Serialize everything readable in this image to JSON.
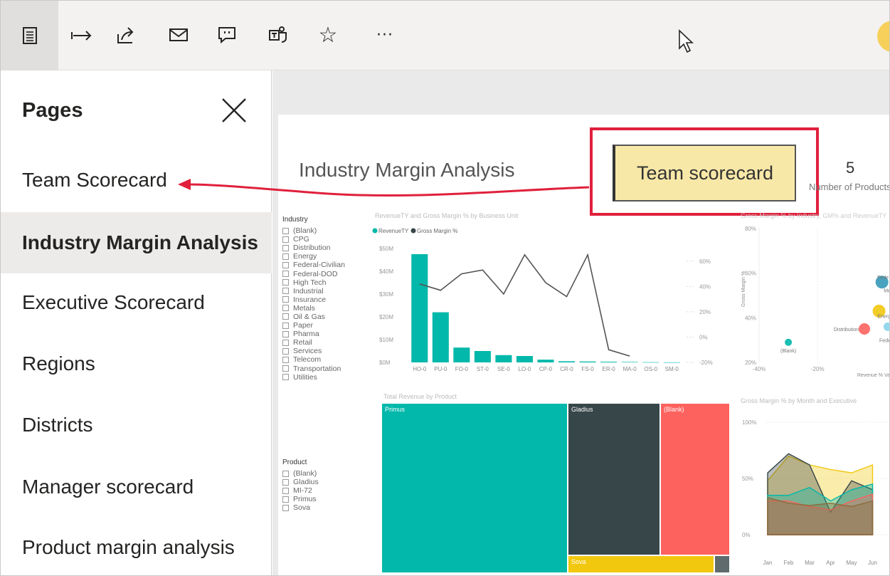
{
  "toolbar": {
    "icons": [
      "pages-icon",
      "expand-icon",
      "share-icon",
      "mail-icon",
      "comment-icon",
      "teams-icon",
      "favorite-icon",
      "more-icon"
    ],
    "more_label": "···"
  },
  "sidebar": {
    "title": "Pages",
    "items": [
      {
        "label": "Team Scorecard",
        "selected": false
      },
      {
        "label": "Industry Margin Analysis",
        "selected": true
      },
      {
        "label": "Executive Scorecard",
        "selected": false
      },
      {
        "label": "Regions",
        "selected": false
      },
      {
        "label": "Districts",
        "selected": false
      },
      {
        "label": "Manager scorecard",
        "selected": false
      },
      {
        "label": "Product margin analysis",
        "selected": false
      }
    ]
  },
  "report": {
    "title": "Industry Margin Analysis",
    "team_button_label": "Team scorecard",
    "kpi_value": "5",
    "kpi_label": "Number of Products",
    "industry_slicer": {
      "title": "Industry",
      "items": [
        "(Blank)",
        "CPG",
        "Distribution",
        "Energy",
        "Federal-Civilian",
        "Federal-DOD",
        "High Tech",
        "Industrial",
        "Insurance",
        "Metals",
        "Oil & Gas",
        "Paper",
        "Pharma",
        "Retail",
        "Services",
        "Telecom",
        "Transportation",
        "Utilities"
      ]
    },
    "product_slicer": {
      "title": "Product",
      "items": [
        "(Blank)",
        "Gladius",
        "MI-72",
        "Primus",
        "Sova"
      ]
    },
    "combo_title": "RevenueTY and Gross Margin % by Business Unit",
    "combo_legend": [
      "RevenueTY",
      "Gross Margin %"
    ],
    "scatter_title": "Gross Margin % by Industry, GM% and RevenueTY",
    "scatter_labels": {
      "ylabel": "Gross Margin %",
      "xlabel": "Revenue % Va",
      "blank": "(Blank)",
      "distribution": "Distribution",
      "fed1": "Fede",
      "fed2": "Fede",
      "me": "Me",
      "energy": "Energ",
      "ut": "Uti"
    },
    "treemap_title": "Total Revenue by Product",
    "treemap": [
      {
        "label": "Primus",
        "color": "#01b8aa"
      },
      {
        "label": "Gladius",
        "color": "#374649"
      },
      {
        "label": "(Blank)",
        "color": "#fd625e"
      },
      {
        "label": "Sova",
        "color": "#f2c80f"
      }
    ],
    "area_title": "Gross Margin % by Month and Executive",
    "area_months": [
      "Jan",
      "Feb",
      "Mar",
      "Apr",
      "May",
      "Jun"
    ],
    "colors": {
      "teal": "#01b8aa",
      "dark": "#374649",
      "red": "#fd625e",
      "yellow": "#f2c80f",
      "highlight": "#e0203c",
      "button": "#f8e8a8"
    }
  },
  "chart_data": [
    {
      "type": "bar",
      "title": "RevenueTY and Gross Margin % by Business Unit",
      "categories": [
        "HO-0",
        "PU-0",
        "FO-0",
        "ST-0",
        "SE-0",
        "LO-0",
        "CP-0",
        "CR-0",
        "FS-0",
        "ER-0",
        "MA-0",
        "OS-0",
        "SM-0"
      ],
      "series": [
        {
          "name": "RevenueTY",
          "type": "bar",
          "values": [
            47.5,
            22,
            6.5,
            5,
            3.2,
            2.8,
            1.2,
            0.5,
            0.4,
            0.3,
            0.2,
            0.1,
            0.05
          ]
        },
        {
          "name": "Gross Margin %",
          "type": "line",
          "values": [
            42,
            37,
            50,
            53,
            34,
            65,
            43,
            32,
            65,
            -10,
            -15,
            null,
            null
          ]
        }
      ],
      "y_ticks": [
        "$0M",
        "$10M",
        "$20M",
        "$30M",
        "$40M",
        "$50M"
      ],
      "y2_ticks": [
        "-20%",
        "0%",
        "20%",
        "40%",
        "60%"
      ],
      "ylim": [
        0,
        50
      ],
      "y2lim": [
        -20,
        70
      ]
    },
    {
      "type": "scatter",
      "title": "Gross Margin % by Industry, GM% and RevenueTY",
      "x_ticks": [
        "-40%",
        "-20%"
      ],
      "y_ticks": [
        "20%",
        "40%",
        "60%",
        "80%"
      ],
      "points": [
        {
          "label": "(Blank)",
          "x": -30,
          "y": 29
        },
        {
          "label": "Distribution",
          "x": -4,
          "y": 35
        },
        {
          "label": "Energy",
          "x": 1,
          "y": 43
        },
        {
          "label": "Federal",
          "x": 2,
          "y": 56
        }
      ]
    },
    {
      "type": "area",
      "title": "Gross Margin % by Month and Executive",
      "categories": [
        "Jan",
        "Feb",
        "Mar",
        "Apr",
        "May",
        "Jun"
      ],
      "y_ticks": [
        "0%",
        "50%",
        "100%"
      ],
      "series": [
        {
          "color": "#f2c80f",
          "values": [
            48,
            70,
            62,
            58,
            55,
            62
          ]
        },
        {
          "color": "#374649",
          "values": [
            55,
            72,
            62,
            20,
            48,
            40
          ]
        },
        {
          "color": "#01b8aa",
          "values": [
            35,
            35,
            42,
            30,
            40,
            45
          ]
        },
        {
          "color": "#fd625e",
          "values": [
            30,
            30,
            25,
            22,
            30,
            36
          ]
        },
        {
          "color": "#8b6b3a",
          "values": [
            33,
            28,
            26,
            28,
            25,
            30
          ]
        }
      ]
    }
  ]
}
